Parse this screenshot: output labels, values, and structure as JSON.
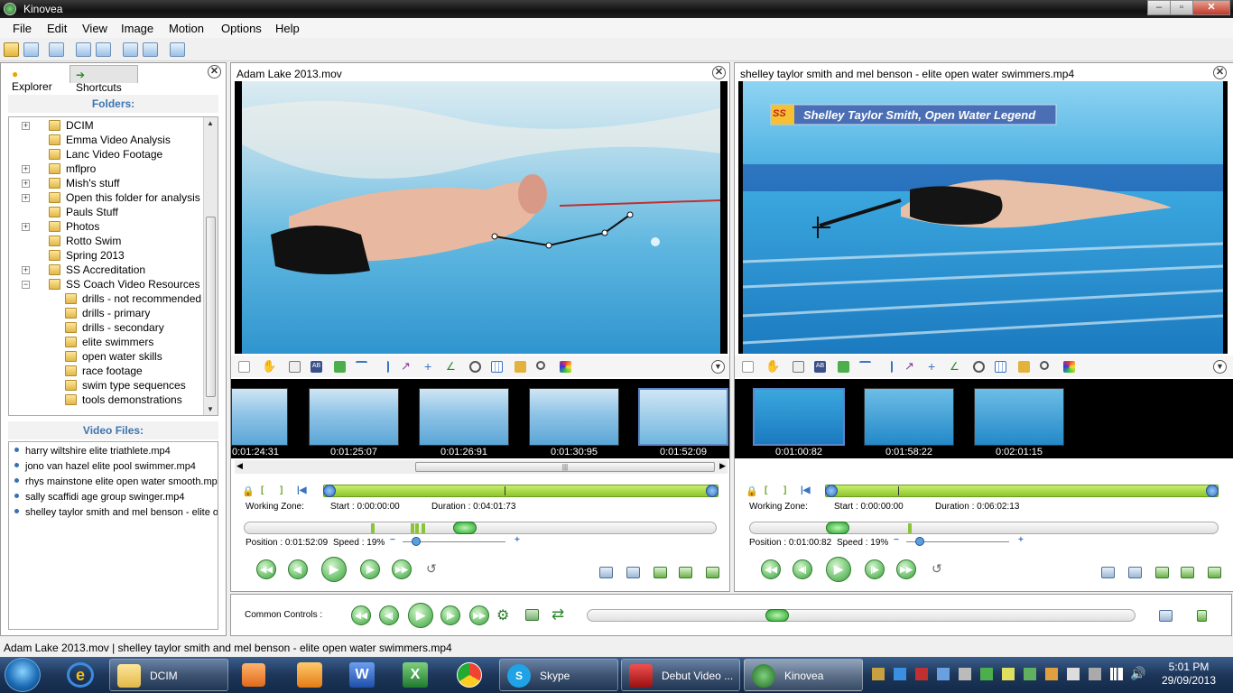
{
  "window": {
    "title": "Kinovea",
    "min": "–",
    "max": "▫",
    "close": "✕"
  },
  "menu": [
    "File",
    "Edit",
    "View",
    "Image",
    "Motion",
    "Options",
    "Help"
  ],
  "left": {
    "tabs": {
      "explorer": "Explorer",
      "shortcuts": "Shortcuts"
    },
    "folders_title": "Folders:",
    "folders": [
      {
        "label": "DCIM",
        "expander": "+"
      },
      {
        "label": "Emma Video Analysis",
        "expander": ""
      },
      {
        "label": "Lanc Video Footage",
        "expander": ""
      },
      {
        "label": "mflpro",
        "expander": "+"
      },
      {
        "label": "Mish's stuff",
        "expander": "+"
      },
      {
        "label": "Open this folder for analysis info",
        "expander": "+"
      },
      {
        "label": "Pauls Stuff",
        "expander": ""
      },
      {
        "label": "Photos",
        "expander": "+"
      },
      {
        "label": "Rotto Swim",
        "expander": ""
      },
      {
        "label": "Spring 2013",
        "expander": ""
      },
      {
        "label": "SS Accreditation",
        "expander": "+"
      },
      {
        "label": "SS Coach Video Resources",
        "expander": "−"
      }
    ],
    "subfolders": [
      "drills - not recommended",
      "drills - primary",
      "drills - secondary",
      "elite swimmers",
      "open water skills",
      "race footage",
      "swim type sequences",
      "tools demonstrations"
    ],
    "files_title": "Video Files:",
    "files": [
      "harry wiltshire elite triathlete.mp4",
      "jono van hazel elite pool swimmer.mp4",
      "rhys mainstone elite open water smooth.mp4",
      "sally scaffidi age group swinger.mp4",
      "shelley taylor smith and mel benson - elite ope"
    ]
  },
  "player1": {
    "title": "Adam Lake 2013.mov",
    "thumbs": [
      "0:01:24:31",
      "0:01:25:07",
      "0:01:26:91",
      "0:01:30:95",
      "0:01:52:09"
    ],
    "working_zone": "Working Zone:",
    "start": "Start : 0:00:00:00",
    "duration": "Duration : 0:04:01:73",
    "position": "Position : 0:01:52:09",
    "speed": "Speed : 19%",
    "position_fraction": 0.465
  },
  "player2": {
    "title": "shelley taylor smith and mel benson - elite open water swimmers.mp4",
    "banner": "Shelley Taylor Smith, Open Water Legend",
    "banner_logo": "SS",
    "thumbs": [
      "0:01:00:82",
      "0:01:58:22",
      "0:02:01:15"
    ],
    "working_zone": "Working Zone:",
    "start": "Start : 0:00:00:00",
    "duration": "Duration : 0:06:02:13",
    "position": "Position : 0:01:00:82",
    "speed": "Speed : 19%",
    "position_fraction": 0.17
  },
  "common": {
    "label": "Common Controls :",
    "position_fraction": 0.34
  },
  "status": "Adam Lake 2013.mov | shelley taylor smith and mel benson - elite open water swimmers.mp4",
  "taskbar": {
    "items": [
      {
        "label": "DCIM",
        "icon": "folder-icon"
      },
      {
        "label": "Skype",
        "icon": "skype-icon"
      },
      {
        "label": "Debut Video ...",
        "icon": "video-icon"
      },
      {
        "label": "Kinovea",
        "icon": "kinovea-icon"
      }
    ],
    "time": "5:01 PM",
    "date": "29/09/2013"
  },
  "colors": {
    "accent": "#3e74b0",
    "zone": "#8fc42f",
    "play": "#3e9a3e"
  }
}
